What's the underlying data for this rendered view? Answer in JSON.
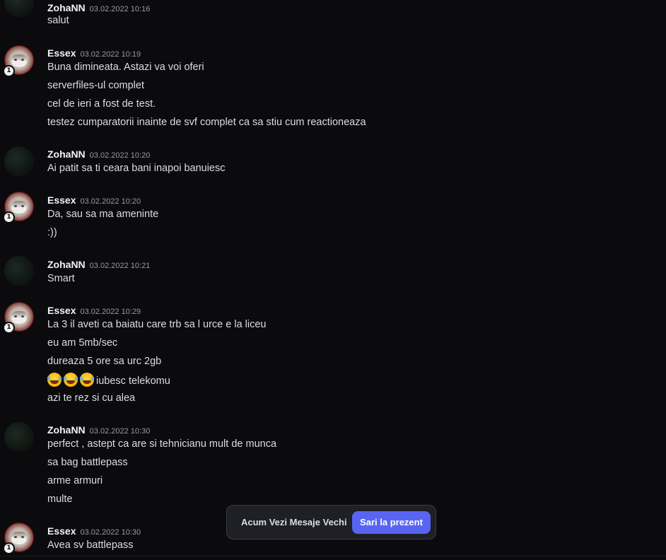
{
  "messages": [
    {
      "author": "ZohaNN",
      "time": "03.02.2022 10:16",
      "avatar": "dark-avatar",
      "lines": [
        "salut"
      ]
    },
    {
      "author": "Essex",
      "time": "03.02.2022 10:19",
      "avatar": "grumpy-cat-avatar",
      "lines": [
        "Buna dimineata. Astazi va voi oferi",
        "serverfiles-ul complet",
        "cel de ieri a fost de test.",
        "testez cumparatorii inainte de svf complet ca sa stiu cum reactioneaza"
      ]
    },
    {
      "author": "ZohaNN",
      "time": "03.02.2022 10:20",
      "avatar": "dark-avatar",
      "lines": [
        "Ai patit sa ti ceara bani inapoi banuiesc"
      ]
    },
    {
      "author": "Essex",
      "time": "03.02.2022 10:20",
      "avatar": "grumpy-cat-avatar",
      "lines": [
        "Da, sau sa ma ameninte",
        ":))"
      ]
    },
    {
      "author": "ZohaNN",
      "time": "03.02.2022 10:21",
      "avatar": "dark-avatar",
      "lines": [
        "Smart"
      ]
    },
    {
      "author": "Essex",
      "time": "03.02.2022 10:29",
      "avatar": "grumpy-cat-avatar",
      "lines": [
        "La 3 il aveti ca baiatu care trb sa l urce e la liceu",
        "eu am 5mb/sec",
        "dureaza 5 ore sa urc 2gb",
        "iubesc telekomu",
        "azi te rez si cu alea"
      ],
      "emoji_line_index": 3,
      "emoji": [
        "😂",
        "😂",
        "😂"
      ]
    },
    {
      "author": "ZohaNN",
      "time": "03.02.2022 10:30",
      "avatar": "dark-avatar",
      "lines": [
        "perfect , astept ca are si tehnicianu mult de munca",
        "sa bag battlepass",
        "arme armuri",
        "multe"
      ]
    },
    {
      "author": "Essex",
      "time": "03.02.2022 10:30",
      "avatar": "grumpy-cat-avatar",
      "lines": [
        "Avea sv battlepass"
      ]
    }
  ],
  "avatar_badge": "1",
  "jump_bar": {
    "label": "Acum Vezi Mesaje Vechi",
    "button": "Sari la prezent"
  },
  "colors": {
    "background": "#0b0b0d",
    "username": "#f2f3f5",
    "timestamp": "#949ba4",
    "message_text": "#dbdee1",
    "accent": "#5865f2"
  }
}
